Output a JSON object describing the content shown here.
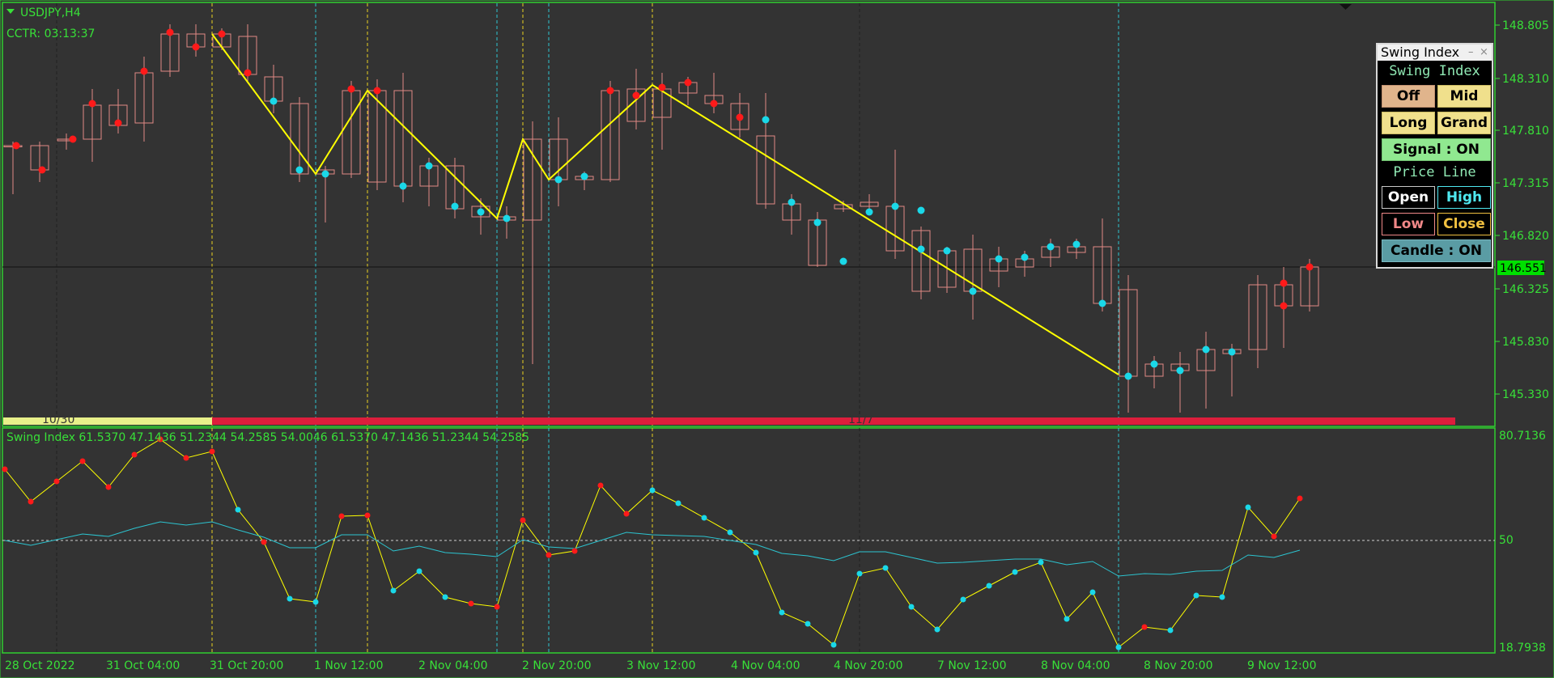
{
  "chart": {
    "symbol_label": "USDJPY,H4",
    "cctr_label": "CCTR: 03:13:37",
    "indicator_label": "Swing Index 61.5370 47.1436 51.2344 54.2585 54.0046 61.5370 47.1436 51.2344 54.2585",
    "current_price": "146.551",
    "price_axis_labels": [
      "148.805",
      "148.310",
      "147.810",
      "147.315",
      "146.820",
      "146.325",
      "145.830",
      "145.330"
    ],
    "indicator_axis_labels": [
      "80.7136",
      "50",
      "18.7938"
    ],
    "time_axis_labels": [
      "28 Oct 2022",
      "31 Oct 04:00",
      "31 Oct 20:00",
      "1 Nov 12:00",
      "2 Nov 04:00",
      "2 Nov 20:00",
      "3 Nov 12:00",
      "4 Nov 04:00",
      "4 Nov 20:00",
      "7 Nov 12:00",
      "8 Nov 04:00",
      "8 Nov 20:00",
      "9 Nov 12:00"
    ],
    "session_labels": [
      "10/30",
      "11/7"
    ],
    "colors": {
      "background": "#333333",
      "frame": "#2fd02f",
      "axis_text": "#38e038",
      "bull_candle": "#3fae84",
      "bear_candle": "#e08a84",
      "zigzag": "#ffff00",
      "swing_high_dot": "#ff1a1a",
      "swing_low_dot": "#1ad8e8",
      "signal_line": "#2cc4d0",
      "session_bar_1": "#e8f08a",
      "session_bar_2": "#dc1e3c"
    }
  },
  "panel": {
    "title": "Swing Index",
    "minimize_glyph": "–",
    "close_glyph": "×",
    "swing_section_label": "Swing Index",
    "price_line_label": "Price Line",
    "buttons": {
      "off": "Off",
      "mid": "Mid",
      "long": "Long",
      "grand": "Grand",
      "signal": "Signal : ON",
      "open": "Open",
      "high": "High",
      "low": "Low",
      "close": "Close",
      "candle": "Candle : ON"
    }
  }
}
